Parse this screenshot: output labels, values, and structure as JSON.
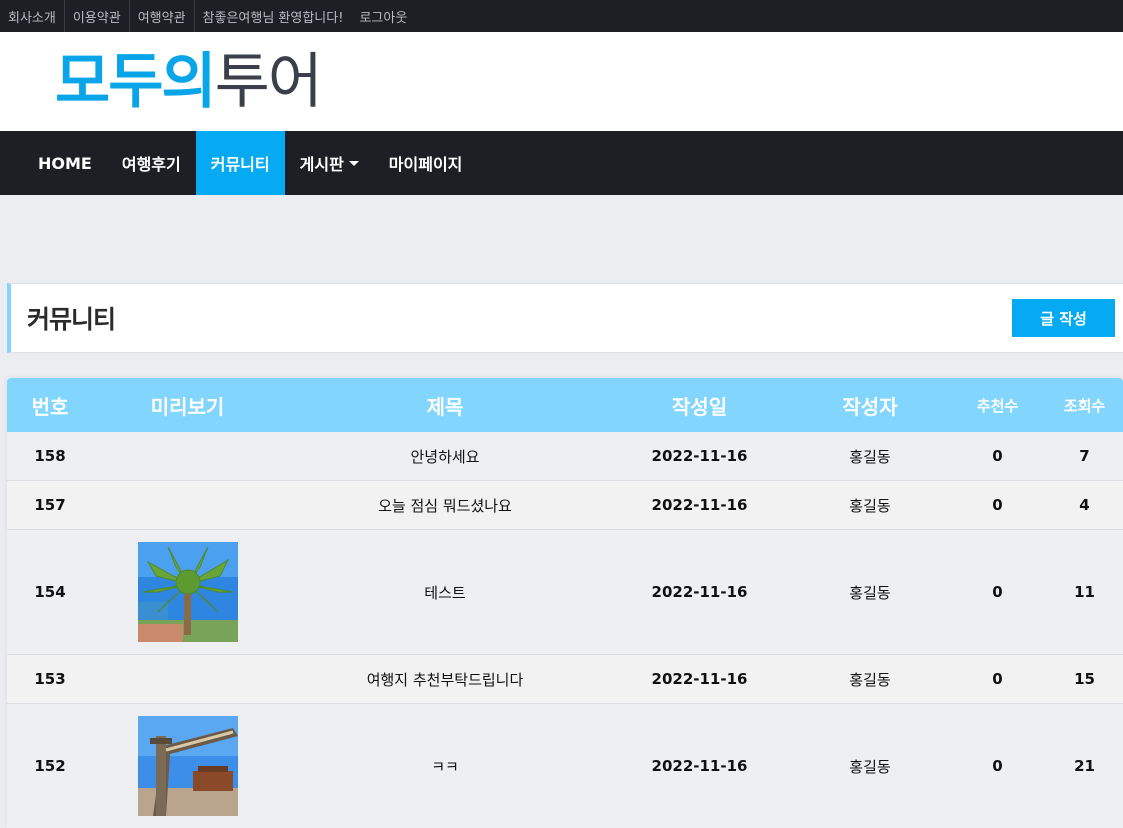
{
  "topbar": {
    "links": [
      "회사소개",
      "이용약관",
      "여행약관",
      "참좋은여행님 환영합니다!",
      "로그아웃"
    ]
  },
  "logo": {
    "part1": "모두의",
    "part2": "투어"
  },
  "nav": {
    "home": "HOME",
    "reviews": "여행후기",
    "community": "커뮤니티",
    "board": "게시판",
    "mypage": "마이페이지"
  },
  "page": {
    "title": "커뮤니티",
    "write_button": "글 작성"
  },
  "table": {
    "headers": {
      "num": "번호",
      "preview": "미리보기",
      "title": "제목",
      "date": "작성일",
      "writer": "작성자",
      "recommend": "추천수",
      "views": "조회수"
    },
    "rows": [
      {
        "num": "158",
        "title": "안녕하세요",
        "date": "2022-11-16",
        "writer": "홍길동",
        "recommend": "0",
        "views": "7",
        "preview": ""
      },
      {
        "num": "157",
        "title": "오늘 점심 뭐드셨나요",
        "date": "2022-11-16",
        "writer": "홍길동",
        "recommend": "0",
        "views": "4",
        "preview": ""
      },
      {
        "num": "154",
        "title": "테스트",
        "date": "2022-11-16",
        "writer": "홍길동",
        "recommend": "0",
        "views": "11",
        "preview": "palm-tree-photo"
      },
      {
        "num": "153",
        "title": "여행지 추천부탁드립니다",
        "date": "2022-11-16",
        "writer": "홍길동",
        "recommend": "0",
        "views": "15",
        "preview": ""
      },
      {
        "num": "152",
        "title": "ㅋㅋ",
        "date": "2022-11-16",
        "writer": "홍길동",
        "recommend": "0",
        "views": "21",
        "preview": "gate-photo"
      }
    ]
  },
  "colors": {
    "accent": "#05aaf2",
    "header_bg": "#82d5fc",
    "dark": "#1e1f24"
  }
}
